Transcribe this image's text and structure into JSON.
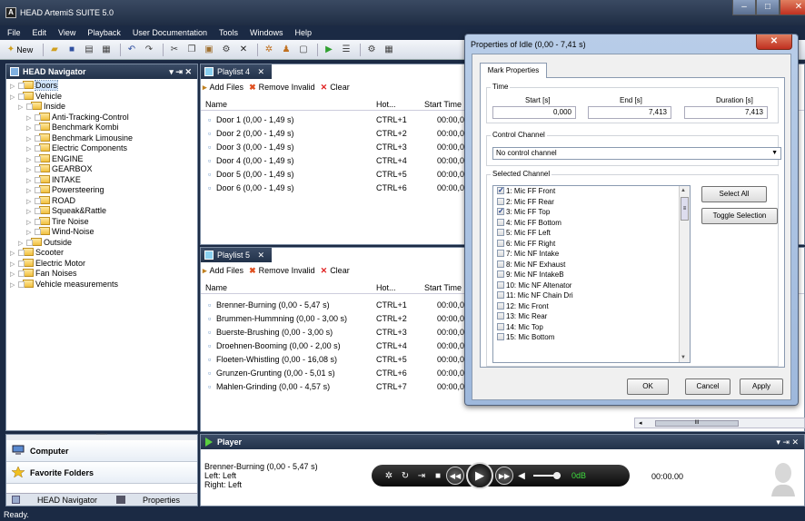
{
  "window": {
    "title": "HEAD ArtemiS SUITE 5.0",
    "min": "–",
    "max": "□",
    "close": "✕",
    "app_icon": "A"
  },
  "menu": [
    "File",
    "Edit",
    "View",
    "Playback",
    "User Documentation",
    "Tools",
    "Windows",
    "Help"
  ],
  "toolbar": {
    "new_label": "New"
  },
  "navigator": {
    "title": "HEAD Navigator",
    "controls": "▾ ⇥ ✕",
    "tree": [
      {
        "label": "Doors",
        "level": 0,
        "selected": true
      },
      {
        "label": "Vehicle",
        "level": 0
      },
      {
        "label": "Inside",
        "level": 1
      },
      {
        "label": "Anti-Tracking-Control",
        "level": 2
      },
      {
        "label": "Benchmark Kombi",
        "level": 2
      },
      {
        "label": "Benchmark Limousine",
        "level": 2
      },
      {
        "label": "Electric Components",
        "level": 2
      },
      {
        "label": "ENGINE",
        "level": 2
      },
      {
        "label": "GEARBOX",
        "level": 2
      },
      {
        "label": "INTAKE",
        "level": 2
      },
      {
        "label": "Powersteering",
        "level": 2
      },
      {
        "label": "ROAD",
        "level": 2
      },
      {
        "label": "Squeak&Rattle",
        "level": 2
      },
      {
        "label": "Tire Noise",
        "level": 2
      },
      {
        "label": "Wind-Noise",
        "level": 2
      },
      {
        "label": "Outside",
        "level": 1
      },
      {
        "label": "Scooter",
        "level": 0
      },
      {
        "label": "Electric Motor",
        "level": 0
      },
      {
        "label": "Fan Noises",
        "level": 0
      },
      {
        "label": "Vehicle measurements",
        "level": 0
      }
    ]
  },
  "nav_bottom": {
    "computer": "Computer",
    "favorites": "Favorite Folders",
    "tab_navigator": "HEAD Navigator",
    "tab_properties": "Properties",
    "grip": "''''''''''"
  },
  "playlist4": {
    "tab": "Playlist 4",
    "add_files": "Add Files",
    "remove_invalid": "Remove Invalid",
    "clear": "Clear",
    "columns": {
      "name": "Name",
      "hotkey": "Hot...",
      "start": "Start Time"
    },
    "rows": [
      {
        "name": "Door 1 (0,00 - 1,49 s)",
        "hotkey": "CTRL+1",
        "start": "00:00,00"
      },
      {
        "name": "Door 2 (0,00 - 1,49 s)",
        "hotkey": "CTRL+2",
        "start": "00:00,00"
      },
      {
        "name": "Door 3 (0,00 - 1,49 s)",
        "hotkey": "CTRL+3",
        "start": "00:00,00"
      },
      {
        "name": "Door 4 (0,00 - 1,49 s)",
        "hotkey": "CTRL+4",
        "start": "00:00,00"
      },
      {
        "name": "Door 5 (0,00 - 1,49 s)",
        "hotkey": "CTRL+5",
        "start": "00:00,00"
      },
      {
        "name": "Door 6 (0,00 - 1,49 s)",
        "hotkey": "CTRL+6",
        "start": "00:00,00"
      }
    ]
  },
  "playlist5": {
    "tab": "Playlist 5",
    "add_files": "Add Files",
    "remove_invalid": "Remove Invalid",
    "clear": "Clear",
    "columns": {
      "name": "Name",
      "hotkey": "Hot...",
      "start": "Start Time"
    },
    "rows": [
      {
        "name": "Brenner-Burning (0,00 - 5,47 s)",
        "hotkey": "CTRL+1",
        "start": "00:00,00"
      },
      {
        "name": "Brummen-Hummning (0,00 - 3,00 s)",
        "hotkey": "CTRL+2",
        "start": "00:00,00"
      },
      {
        "name": "Buerste-Brushing (0,00 - 3,00 s)",
        "hotkey": "CTRL+3",
        "start": "00:00,00"
      },
      {
        "name": "Droehnen-Booming (0,00 - 2,00 s)",
        "hotkey": "CTRL+4",
        "start": "00:00,00"
      },
      {
        "name": "Floeten-Whistling (0,00 - 16,08 s)",
        "hotkey": "CTRL+5",
        "start": "00:00,00"
      },
      {
        "name": "Grunzen-Grunting (0,00 - 5,01 s)",
        "hotkey": "CTRL+6",
        "start": "00:00,00"
      },
      {
        "name": "Mahlen-Grinding (0,00 - 4,57 s)",
        "hotkey": "CTRL+7",
        "start": "00:00,00"
      }
    ]
  },
  "player": {
    "title": "Player",
    "controls": "▾ ⇥ ✕",
    "track": "Brenner-Burning (0,00 - 5,47 s)",
    "left": "Left: Left",
    "right": "Right: Left",
    "db": "0dB",
    "time": "00:00.00"
  },
  "hscroll_grip": "III",
  "status": "Ready.",
  "dialog": {
    "title": "Properties of Idle (0,00 - 7,41 s)",
    "close": "✕",
    "tab": "Mark Properties",
    "time_group": "Time",
    "start_label": "Start [s]",
    "end_label": "End [s]",
    "duration_label": "Duration [s]",
    "start": "0,000",
    "end": "7,413",
    "duration": "7,413",
    "control_group": "Control Channel",
    "control_value": "No control channel",
    "selected_group": "Selected Channel",
    "channels": [
      {
        "label": "1: Mic FF  Front",
        "checked": true
      },
      {
        "label": "2: Mic FF  Rear",
        "checked": false
      },
      {
        "label": "3: Mic FF  Top",
        "checked": true
      },
      {
        "label": "4: Mic FF  Bottom",
        "checked": false
      },
      {
        "label": "5: Mic FF  Left",
        "checked": false
      },
      {
        "label": "6: Mic FF  Right",
        "checked": false
      },
      {
        "label": "7: Mic NF  Intake",
        "checked": false
      },
      {
        "label": "8: Mic NF  Exhaust",
        "checked": false
      },
      {
        "label": "9: Mic NF IntakeB",
        "checked": false
      },
      {
        "label": "10: Mic NF Altenator",
        "checked": false
      },
      {
        "label": "11: Mic NF Chain Dri",
        "checked": false
      },
      {
        "label": "12: Mic Front",
        "checked": false
      },
      {
        "label": "13: Mic Rear",
        "checked": false
      },
      {
        "label": "14: Mic Top",
        "checked": false
      },
      {
        "label": "15: Mic Bottom",
        "checked": false
      }
    ],
    "select_all": "Select All",
    "toggle_selection": "Toggle Selection",
    "ok": "OK",
    "cancel": "Cancel",
    "apply": "Apply"
  }
}
